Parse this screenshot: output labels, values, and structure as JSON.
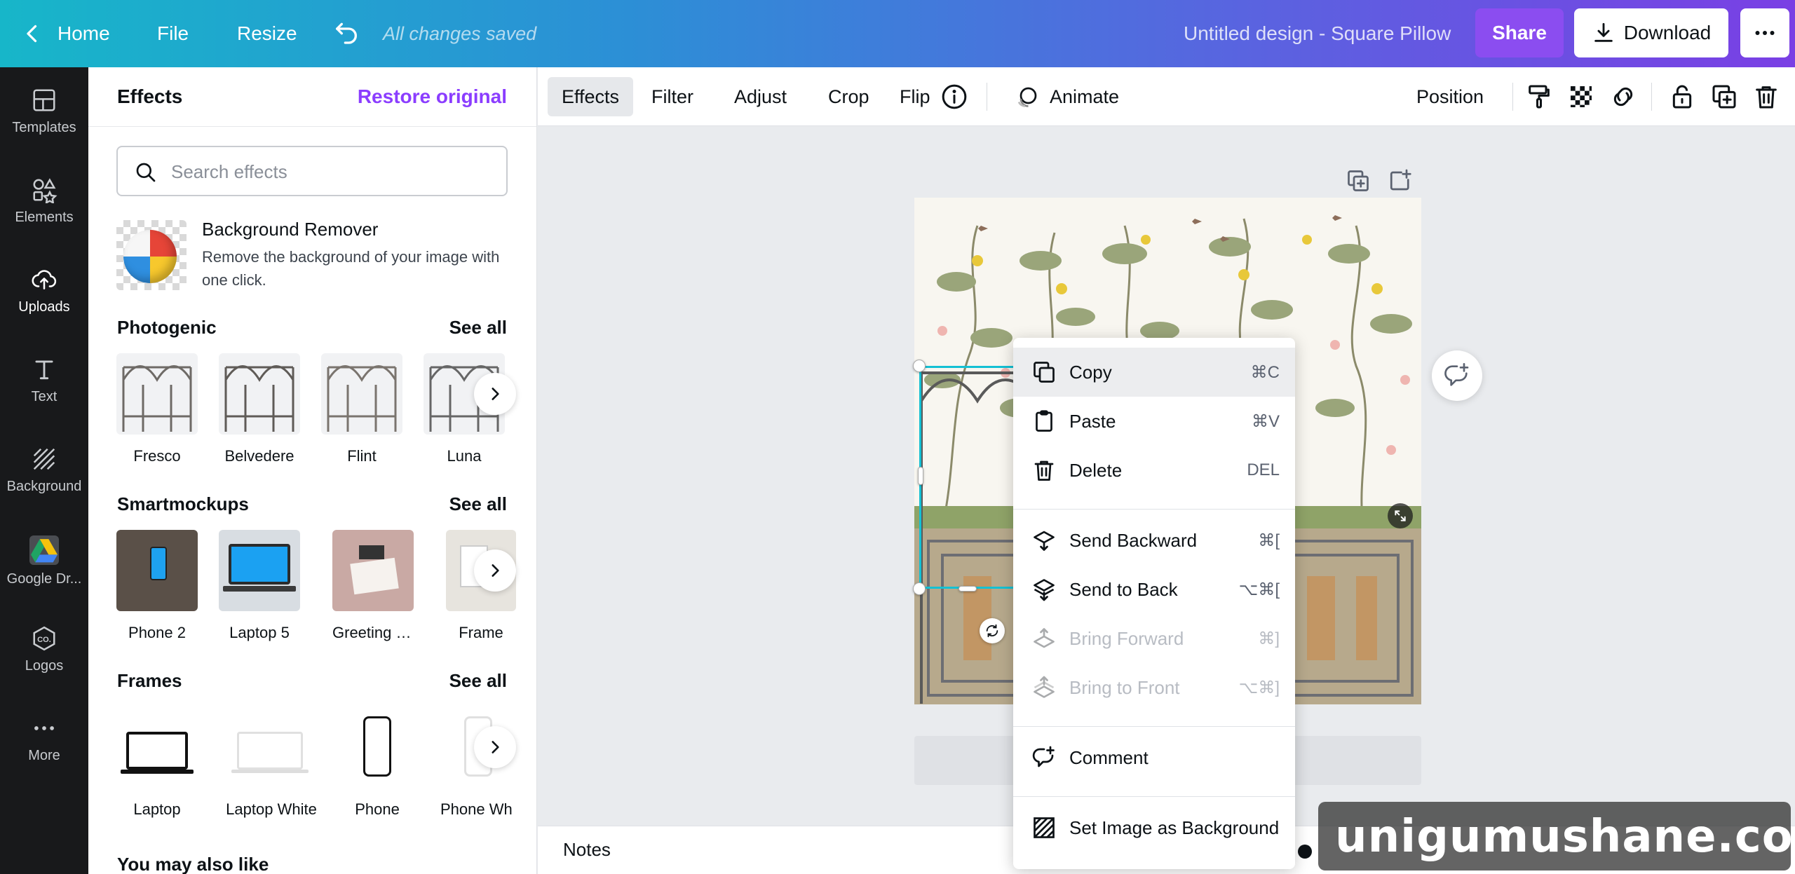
{
  "topbar": {
    "home": "Home",
    "file": "File",
    "resize": "Resize",
    "saved_status": "All changes saved",
    "design_title": "Untitled design - Square Pillow",
    "share": "Share",
    "download": "Download"
  },
  "rail": {
    "templates": "Templates",
    "elements": "Elements",
    "uploads": "Uploads",
    "text": "Text",
    "background": "Background",
    "google_drive": "Google Dr...",
    "logos": "Logos",
    "more": "More"
  },
  "panel": {
    "title": "Effects",
    "restore": "Restore original",
    "search_placeholder": "Search effects",
    "bg_remover": {
      "title": "Background Remover",
      "description": "Remove the background of your image with one click."
    },
    "photogenic": {
      "title": "Photogenic",
      "see_all": "See all",
      "items": [
        "Fresco",
        "Belvedere",
        "Flint",
        "Luna"
      ]
    },
    "smartmockups": {
      "title": "Smartmockups",
      "see_all": "See all",
      "items": [
        "Phone 2",
        "Laptop 5",
        "Greeting car...",
        "Frame"
      ]
    },
    "frames": {
      "title": "Frames",
      "see_all": "See all",
      "items": [
        "Laptop",
        "Laptop White",
        "Phone",
        "Phone Wh"
      ]
    },
    "you_may_also_like": "You may also like"
  },
  "toolbar": {
    "effects": "Effects",
    "filter": "Filter",
    "adjust": "Adjust",
    "crop": "Crop",
    "flip": "Flip",
    "animate": "Animate",
    "position": "Position"
  },
  "context_menu": {
    "copy": {
      "label": "Copy",
      "shortcut": "⌘C"
    },
    "paste": {
      "label": "Paste",
      "shortcut": "⌘V"
    },
    "delete": {
      "label": "Delete",
      "shortcut": "DEL"
    },
    "send_backward": {
      "label": "Send Backward",
      "shortcut": "⌘["
    },
    "send_to_back": {
      "label": "Send to Back",
      "shortcut": "⌥⌘["
    },
    "bring_forward": {
      "label": "Bring Forward",
      "shortcut": "⌘]"
    },
    "bring_to_front": {
      "label": "Bring to Front",
      "shortcut": "⌥⌘]"
    },
    "comment": {
      "label": "Comment"
    },
    "set_background": {
      "label": "Set Image as Background"
    }
  },
  "notes": {
    "label": "Notes"
  },
  "watermark": "unigumushane.com",
  "colors": {
    "accent": "#8b3dff",
    "selection": "#14c1d4",
    "topbar_start": "#17b6c9",
    "topbar_end": "#7a3fe4"
  }
}
